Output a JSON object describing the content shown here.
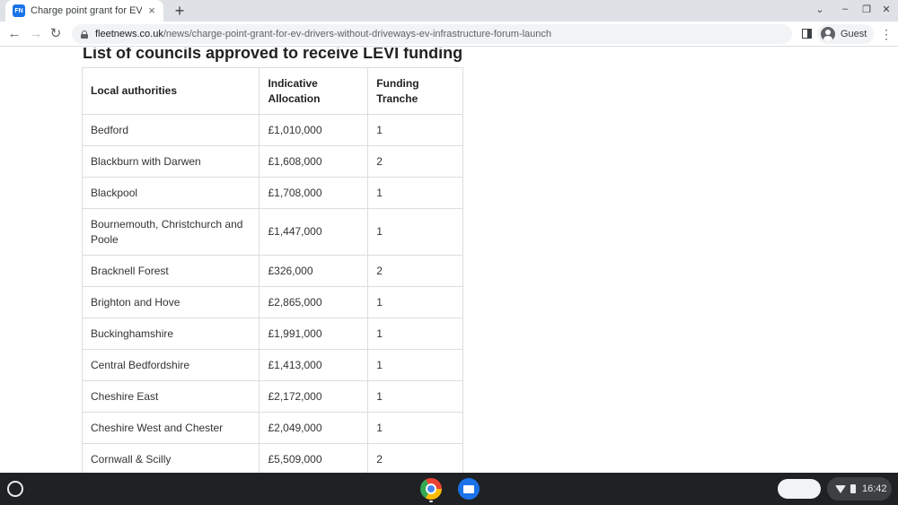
{
  "browser": {
    "tab_title": "Charge point grant for EV drivers without driveways",
    "favicon_text": "FN",
    "tab_close_icon": "×",
    "new_tab_icon": "+",
    "window_controls": [
      "⌄",
      "–",
      "❐",
      "✕"
    ],
    "nav": {
      "back": "←",
      "forward": "→",
      "reload": "↻"
    },
    "url_host": "fleetnews.co.uk",
    "url_path": "/news/charge-point-grant-for-ev-drivers-without-driveways-ev-infrastructure-forum-launch",
    "profile_label": "Guest",
    "menu_icon": "⋮"
  },
  "page": {
    "heading": "List of councils approved to receive LEVI funding",
    "table": {
      "headers": [
        "Local authorities",
        "Indicative Allocation",
        "Funding Tranche"
      ],
      "rows": [
        [
          "Bedford",
          "£1,010,000",
          "1"
        ],
        [
          "Blackburn with Darwen",
          "£1,608,000",
          "2"
        ],
        [
          "Blackpool",
          "£1,708,000",
          "1"
        ],
        [
          "Bournemouth, Christchurch and Poole",
          "£1,447,000",
          "1"
        ],
        [
          "Bracknell Forest",
          "£326,000",
          "2"
        ],
        [
          "Brighton and Hove",
          "£2,865,000",
          "1"
        ],
        [
          "Buckinghamshire",
          "£1,991,000",
          "1"
        ],
        [
          "Central Bedfordshire",
          "£1,413,000",
          "1"
        ],
        [
          "Cheshire East",
          "£2,172,000",
          "1"
        ],
        [
          "Cheshire West and Chester",
          "£2,049,000",
          "1"
        ],
        [
          "Cornwall & Scilly",
          "£5,509,000",
          "2"
        ]
      ]
    }
  },
  "shelf": {
    "clock": "16:42"
  },
  "colors": {
    "tabstrip": "#dee1e6",
    "shelf": "#202124",
    "accent": "#1a73e8"
  }
}
